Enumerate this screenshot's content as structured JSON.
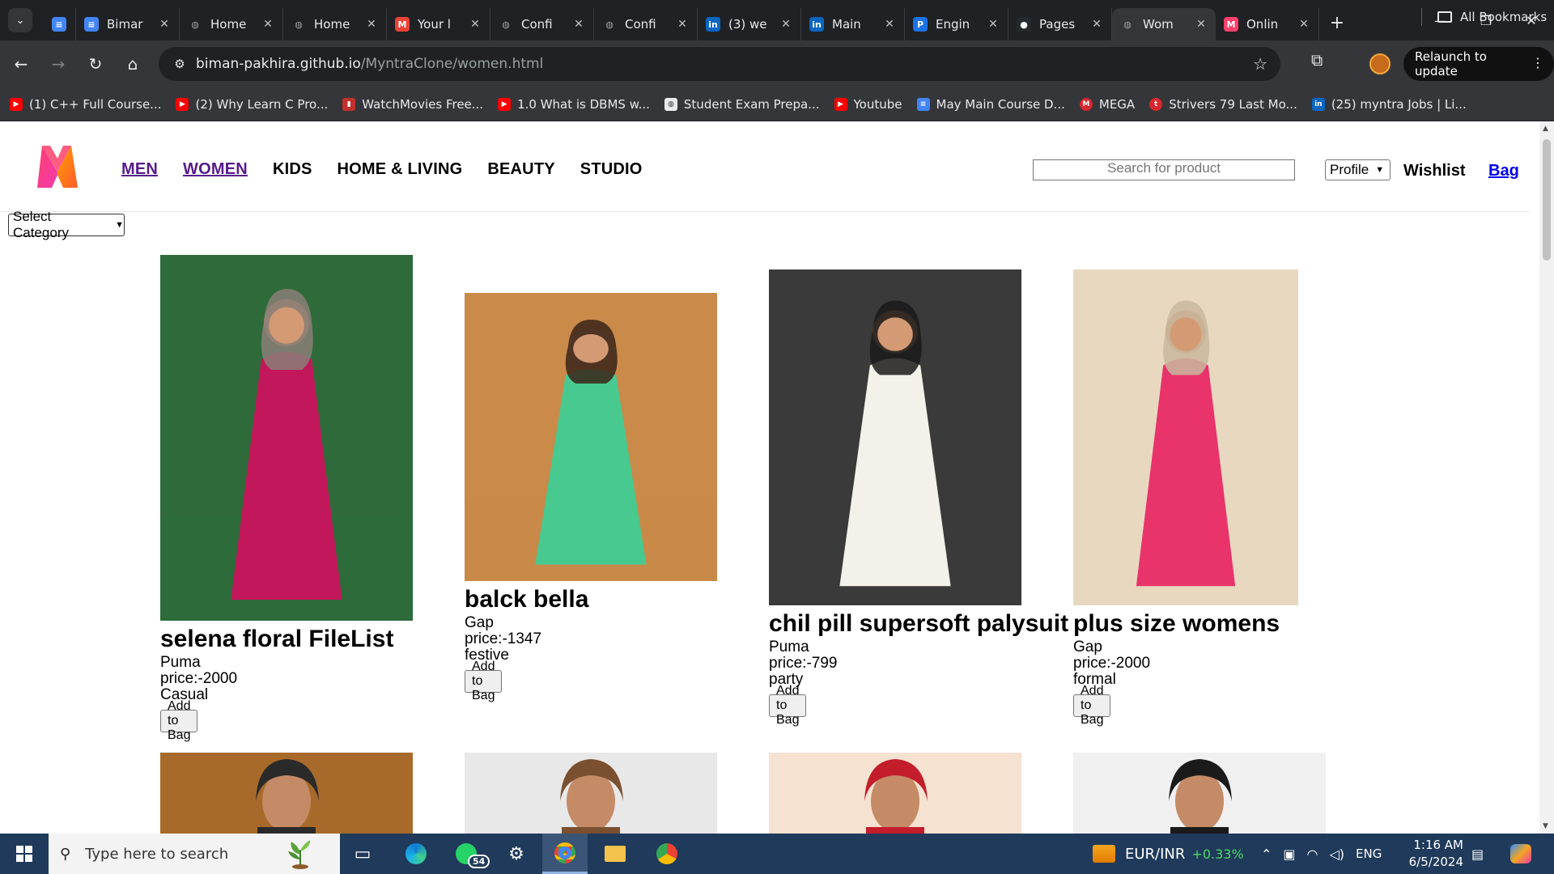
{
  "browser": {
    "tabs": [
      {
        "label": "",
        "icon": "docs-icon",
        "color": "#4285f4"
      },
      {
        "label": "Bimar",
        "icon": "docs-icon",
        "color": "#4285f4"
      },
      {
        "label": "Home",
        "icon": "globe-icon",
        "color": "#9aa0a6"
      },
      {
        "label": "Home",
        "icon": "globe-icon",
        "color": "#9aa0a6"
      },
      {
        "label": "Your l",
        "icon": "gmail-icon",
        "color": "#ea4335"
      },
      {
        "label": "Confi",
        "icon": "globe-icon",
        "color": "#9aa0a6"
      },
      {
        "label": "Confi",
        "icon": "globe-icon",
        "color": "#9aa0a6"
      },
      {
        "label": "(3) we",
        "icon": "linkedin-icon",
        "color": "#0a66c2"
      },
      {
        "label": "Main",
        "icon": "linkedin-icon",
        "color": "#0a66c2"
      },
      {
        "label": "Engin",
        "icon": "p-icon",
        "color": "#1a73e8"
      },
      {
        "label": "Pages",
        "icon": "github-icon",
        "color": "#24292f"
      },
      {
        "label": "Wom",
        "icon": "globe-icon",
        "color": "#9aa0a6"
      },
      {
        "label": "Onlin",
        "icon": "myntra-icon",
        "color": "#ff3f6c"
      }
    ],
    "url_host": "biman-pakhira.github.io",
    "url_path": "/MyntraClone/women.html",
    "relaunch_label": "Relaunch to update",
    "bookmarks": [
      {
        "label": "(1) C++ Full Course...",
        "icon": "youtube-icon",
        "color": "#ff0000"
      },
      {
        "label": "(2) Why Learn C Pro...",
        "icon": "youtube-icon",
        "color": "#ff0000"
      },
      {
        "label": "WatchMovies Free...",
        "icon": "bookmark-icon",
        "color": "#c4302b"
      },
      {
        "label": "1.0 What is DBMS w...",
        "icon": "youtube-icon",
        "color": "#ff0000"
      },
      {
        "label": "Student Exam Prepa...",
        "icon": "globe-icon",
        "color": "#9aa0a6"
      },
      {
        "label": "Youtube",
        "icon": "youtube-icon",
        "color": "#ff0000"
      },
      {
        "label": "May Main Course D...",
        "icon": "docs-icon",
        "color": "#4285f4"
      },
      {
        "label": "MEGA",
        "icon": "mega-icon",
        "color": "#d9272e"
      },
      {
        "label": "Strivers 79 Last Mo...",
        "icon": "tuf-icon",
        "color": "#d9272e"
      },
      {
        "label": "(25) myntra Jobs | Li...",
        "icon": "linkedin-icon",
        "color": "#0a66c2"
      }
    ],
    "all_bookmarks": "All Bookmarks"
  },
  "site": {
    "nav": [
      {
        "label": "MEN",
        "link": true
      },
      {
        "label": "WOMEN",
        "link": true
      },
      {
        "label": "KIDS",
        "link": false
      },
      {
        "label": "HOME & LIVING",
        "link": false
      },
      {
        "label": "BEAUTY",
        "link": false
      },
      {
        "label": "STUDIO",
        "link": false
      }
    ],
    "search_placeholder": "Search for product",
    "profile_label": "Profile",
    "wishlist_label": "Wishlist",
    "bag_label": "Bag",
    "category_label": "Select Category",
    "add_label": "Add to Bag",
    "products": [
      {
        "name": "selena floral FileList",
        "brand": "Puma",
        "price": "price:-2000",
        "type": "Casual",
        "colors": [
          "#2f6b3a",
          "#c2185b",
          "#8a7f78"
        ]
      },
      {
        "name": "balck bella",
        "brand": "Gap",
        "price": "price:-1347",
        "type": "festive",
        "colors": [
          "#c98a4a",
          "#48c98f",
          "#3a2318"
        ]
      },
      {
        "name": "chil pill supersoft palysuit",
        "brand": "Puma",
        "price": "price:-799",
        "type": "party",
        "colors": [
          "#3a3a3a",
          "#f4f1ea",
          "#1a1a1a"
        ]
      },
      {
        "name": "plus size womens",
        "brand": "Gap",
        "price": "price:-2000",
        "type": "formal",
        "colors": [
          "#e8d8c0",
          "#e8336b",
          "#c9b89e"
        ]
      }
    ],
    "partial_products": [
      {
        "colors": [
          "#a86a2a",
          "#2a2a2a"
        ]
      },
      {
        "colors": [
          "#e8e8e8",
          "#7a5030"
        ]
      },
      {
        "colors": [
          "#f6e2d0",
          "#c31d2b"
        ]
      },
      {
        "colors": [
          "#f0f0f0",
          "#1a1a1a"
        ]
      }
    ]
  },
  "taskbar": {
    "search_placeholder": "Type here to search",
    "whatsapp_badge": "54",
    "ticker_label": "EUR/INR",
    "ticker_change": "+0.33%",
    "language": "ENG",
    "time": "1:16 AM",
    "date": "6/5/2024"
  }
}
